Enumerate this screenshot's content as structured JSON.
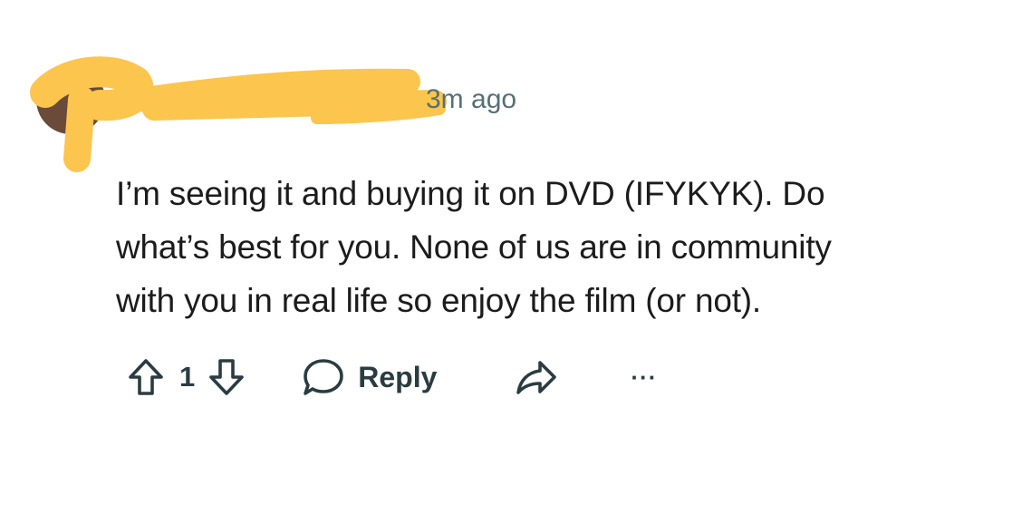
{
  "comment": {
    "author": "",
    "timestamp": "3m ago",
    "body_lines": [
      "I’m seeing it and buying it on DVD (IFYKYK). Do",
      "what’s best for you. None of us are in community",
      "with you in real life so enjoy the film (or not)."
    ],
    "vote_count": "1",
    "reply_label": "Reply",
    "more_label": "···"
  },
  "icons": {
    "upvote": "upvote-icon",
    "downvote": "downvote-icon",
    "reply": "speech-bubble-icon",
    "share": "share-arrow-icon",
    "more": "more-dots-icon"
  },
  "colors": {
    "redaction": "#fcc54e",
    "text": "#1c1c1c",
    "meta": "#576f76",
    "action": "#2a3c42"
  }
}
